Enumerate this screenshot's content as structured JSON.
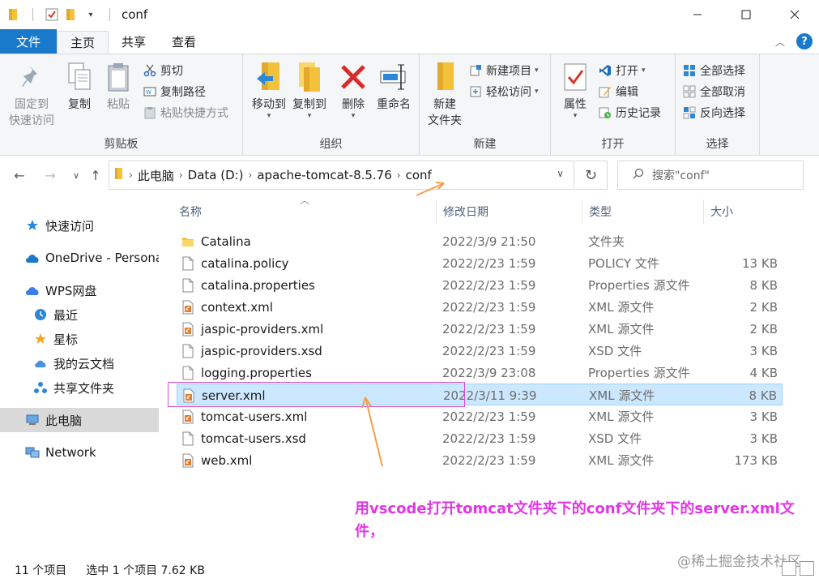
{
  "window": {
    "title": "conf"
  },
  "tabs": [
    {
      "label": "文件"
    },
    {
      "label": "主页"
    },
    {
      "label": "共享"
    },
    {
      "label": "查看"
    }
  ],
  "ribbon": {
    "clipboard": {
      "label": "剪贴板",
      "pin": "固定到\n快速访问",
      "pin_l1": "固定到",
      "pin_l2": "快速访问",
      "copy": "复制",
      "paste": "粘贴",
      "cut": "剪切",
      "copy_path": "复制路径",
      "paste_shortcut": "粘贴快捷方式"
    },
    "organize": {
      "label": "组织",
      "move_to": "移动到",
      "copy_to": "复制到",
      "delete": "删除",
      "rename": "重命名"
    },
    "new": {
      "label": "新建",
      "new_folder_l1": "新建",
      "new_folder_l2": "文件夹",
      "new_item": "新建项目",
      "easy_access": "轻松访问"
    },
    "open": {
      "label": "打开",
      "properties": "属性",
      "open": "打开",
      "edit": "编辑",
      "history": "历史记录"
    },
    "select": {
      "label": "选择",
      "select_all": "全部选择",
      "select_none": "全部取消",
      "invert": "反向选择"
    }
  },
  "address": {
    "crumbs": [
      "此电脑",
      "Data (D:)",
      "apache-tomcat-8.5.76",
      "conf"
    ],
    "search_placeholder": "搜索\"conf\""
  },
  "nav": {
    "quick_access": "快速访问",
    "onedrive": "OneDrive - Persona",
    "wps": "WPS网盘",
    "recent": "最近",
    "starred": "星标",
    "cloud_docs": "我的云文档",
    "shared_folder": "共享文件夹",
    "this_pc": "此电脑",
    "network": "Network"
  },
  "columns": {
    "name": "名称",
    "date": "修改日期",
    "type": "类型",
    "size": "大小"
  },
  "files": [
    {
      "name": "Catalina",
      "date": "2022/3/9 21:50",
      "type": "文件夹",
      "size": "",
      "icon": "folder-icon"
    },
    {
      "name": "catalina.policy",
      "date": "2022/2/23 1:59",
      "type": "POLICY 文件",
      "size": "13 KB",
      "icon": "file-icon"
    },
    {
      "name": "catalina.properties",
      "date": "2022/2/23 1:59",
      "type": "Properties 源文件",
      "size": "8 KB",
      "icon": "file-icon"
    },
    {
      "name": "context.xml",
      "date": "2022/2/23 1:59",
      "type": "XML 源文件",
      "size": "2 KB",
      "icon": "xml-file-icon"
    },
    {
      "name": "jaspic-providers.xml",
      "date": "2022/2/23 1:59",
      "type": "XML 源文件",
      "size": "2 KB",
      "icon": "xml-file-icon"
    },
    {
      "name": "jaspic-providers.xsd",
      "date": "2022/2/23 1:59",
      "type": "XSD 文件",
      "size": "3 KB",
      "icon": "file-icon"
    },
    {
      "name": "logging.properties",
      "date": "2022/3/9 23:08",
      "type": "Properties 源文件",
      "size": "4 KB",
      "icon": "file-icon"
    },
    {
      "name": "server.xml",
      "date": "2022/3/11 9:39",
      "type": "XML 源文件",
      "size": "8 KB",
      "icon": "xml-file-icon"
    },
    {
      "name": "tomcat-users.xml",
      "date": "2022/2/23 1:59",
      "type": "XML 源文件",
      "size": "3 KB",
      "icon": "xml-file-icon"
    },
    {
      "name": "tomcat-users.xsd",
      "date": "2022/2/23 1:59",
      "type": "XSD 文件",
      "size": "3 KB",
      "icon": "file-icon"
    },
    {
      "name": "web.xml",
      "date": "2022/2/23 1:59",
      "type": "XML 源文件",
      "size": "173 KB",
      "icon": "xml-file-icon"
    }
  ],
  "selected_file": "server.xml",
  "annotation": {
    "text": "用vscode打开tomcat文件夹下的conf文件夹下的server.xml文件，"
  },
  "status": {
    "count": "11 个项目",
    "selection": "选中 1 个项目  7.62 KB"
  },
  "watermark": "@稀土掘金技术社区",
  "colors": {
    "accent": "#1979ca",
    "selection": "#cce8ff",
    "annotation": "#e236e6",
    "arrow": "#f5a04a"
  }
}
